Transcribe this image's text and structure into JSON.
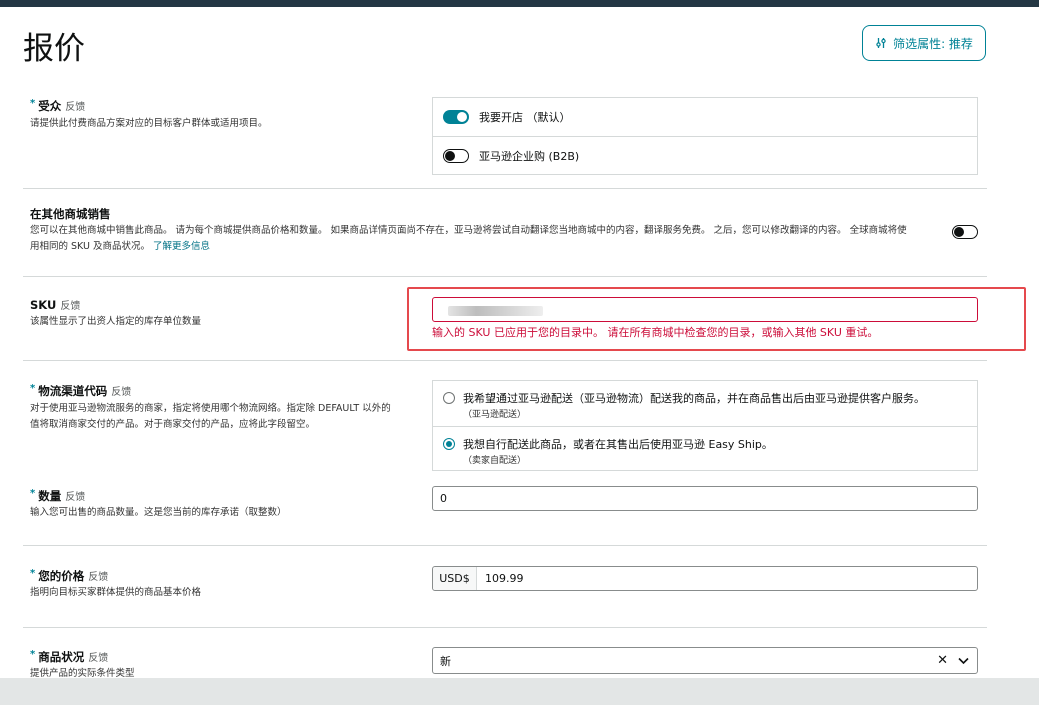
{
  "page": {
    "title": "报价"
  },
  "filter": {
    "label": "筛选属性: 推荐"
  },
  "feedback_label": "反馈",
  "audience": {
    "label": "受众",
    "desc": "请提供此付费商品方案对应的目标客户群体或适用项目。",
    "options": [
      {
        "label": "我要开店 （默认）",
        "state": "on"
      },
      {
        "label": "亚马逊企业购 (B2B)",
        "state": "off"
      }
    ]
  },
  "other_stores": {
    "label": "在其他商城销售",
    "desc_line1": "您可以在其他商城中销售此商品。 请为每个商城提供商品价格和数量。 如果商品详情页面尚不存在，亚马逊将尝试自动翻译您当地商城中的内容，翻译服务免费。 之后，您可以修改翻译的内容。 全球商城将使",
    "desc_line2": "用相同的 SKU 及商品状况。",
    "learn_more": "了解更多信息"
  },
  "sku": {
    "label": "SKU",
    "desc": "该属性显示了出资人指定的库存单位数量",
    "error": "输入的 SKU 已应用于您的目录中。 请在所有商城中检查您的目录，或输入其他 SKU 重试。"
  },
  "fulfillment": {
    "label": "物流渠道代码",
    "desc_lines": [
      "对于使用亚马逊物流服务的商家，指定将使用哪个物流网络。指定除 DEFAULT 以外的",
      "值将取消商家交付的产品。对于商家交付的产品，应将此字段留空。"
    ],
    "options": [
      {
        "label": "我希望通过亚马逊配送（亚马逊物流）配送我的商品，并在商品售出后由亚马逊提供客户服务。",
        "sub": "（亚马逊配送）",
        "selected": false
      },
      {
        "label": "我想自行配送此商品，或者在其售出后使用亚马逊 Easy Ship。",
        "sub": "（卖家自配送）",
        "selected": true
      }
    ]
  },
  "quantity": {
    "label": "数量",
    "desc": "输入您可出售的商品数量。这是您当前的库存承诺（取整数）",
    "value": "0"
  },
  "price": {
    "label": "您的价格",
    "desc": "指明向目标买家群体提供的商品基本价格",
    "currency": "USD$",
    "value": "109.99"
  },
  "condition": {
    "label": "商品状况",
    "desc": "提供产品的实际条件类型",
    "value": "新"
  },
  "colors": {
    "accent": "#008296",
    "error": "#cc0c39",
    "highlight": "#e5494d"
  }
}
